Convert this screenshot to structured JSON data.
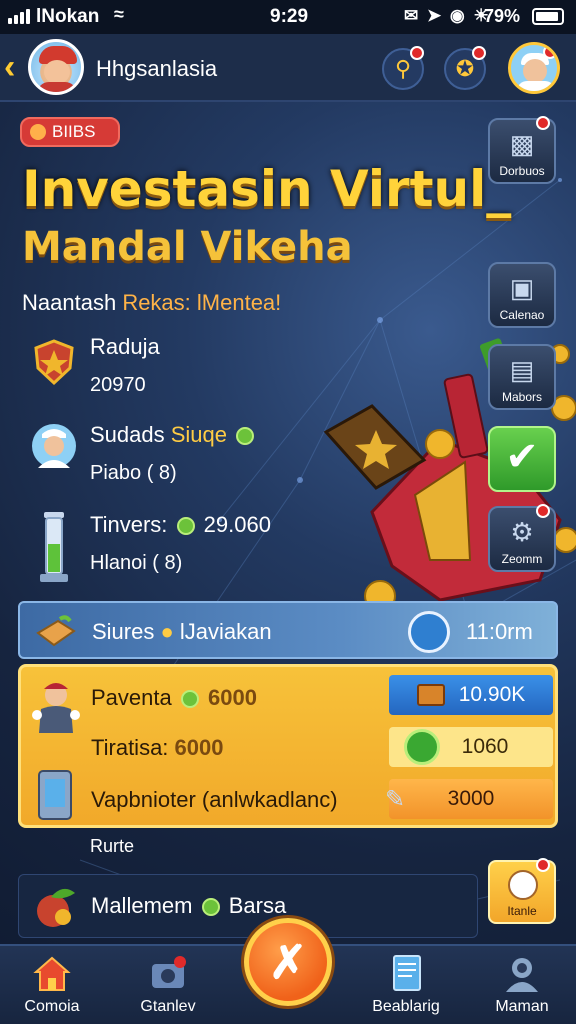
{
  "status_bar": {
    "carrier": "lNokan",
    "time": "9:29",
    "battery": "79%"
  },
  "header": {
    "title": "Hhgsanlasia",
    "back_icon": "chevron-left-icon",
    "actions": [
      {
        "name": "key-icon",
        "badge": true
      },
      {
        "name": "puzzle-icon",
        "badge": true
      }
    ],
    "avatar_badge": true
  },
  "hero": {
    "badge": "BIIBS",
    "title": "Investasin Virtul_",
    "subtitle": "Mandal Vikeha",
    "tagline_prefix": "Naantash",
    "tagline_highlight": "Rekas: lMentea!"
  },
  "side_buttons": [
    {
      "label": "Dorbuos",
      "icon": "chart-icon",
      "badge": true
    },
    {
      "label": "Calenao",
      "icon": "camera-icon",
      "badge": false
    },
    {
      "label": "Mabors",
      "icon": "monitor-icon",
      "badge": false
    },
    {
      "label": "",
      "icon": "check-icon",
      "badge": false
    },
    {
      "label": "Zeomm",
      "icon": "gear-icon",
      "badge": true
    }
  ],
  "stats": [
    {
      "label": "Raduja",
      "value": "20970",
      "icon": "shield-icon"
    },
    {
      "label": "Sudads",
      "label_gold": "Siuqe",
      "value": "Piabo ( 8)",
      "icon": "person-icon"
    },
    {
      "label": "Tinvers:",
      "label_value": "29.060",
      "value": "Hlanoi ( 8)",
      "icon": "tube-icon"
    }
  ],
  "banner": {
    "label": "Siures",
    "label2": "lJaviakan",
    "value": "11:0rm"
  },
  "gold_panel": {
    "rows": [
      {
        "label": "Paventa",
        "amount": "6000",
        "pill": "10.90K"
      },
      {
        "label": "Tiratisa:",
        "amount": "6000",
        "pill": "1060"
      },
      {
        "label": "Vapbnioter (anlwkadlanc)",
        "amount": "",
        "pill": "3000"
      }
    ]
  },
  "extra_label": "Rurte",
  "bottom_card": {
    "label": "Mallemem",
    "label2": "Barsa"
  },
  "chat_button": {
    "label": "Itanle"
  },
  "tabs": [
    {
      "label": "Comoia",
      "icon": "home-icon"
    },
    {
      "label": "Gtanlev",
      "icon": "camera-icon"
    },
    {
      "label": "Beablarig",
      "icon": "document-icon"
    },
    {
      "label": "Maman",
      "icon": "profile-icon"
    }
  ],
  "colors": {
    "accent_gold": "#ffd33a",
    "panel_gold": "#f7c23a",
    "background": "#1b2a44",
    "center_button": "#f0621a"
  }
}
